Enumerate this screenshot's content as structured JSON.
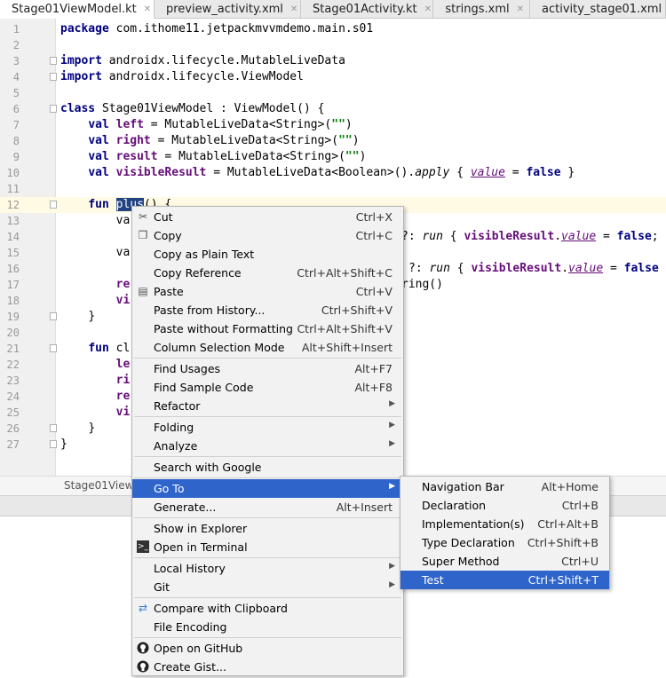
{
  "tabs": [
    {
      "label": "Stage01ViewModel.kt",
      "active": true,
      "icon": "kotlin-class-icon"
    },
    {
      "label": "preview_activity.xml",
      "active": false,
      "icon": "xml-layout-icon"
    },
    {
      "label": "Stage01Activity.kt",
      "active": false,
      "icon": "kotlin-class-icon"
    },
    {
      "label": "strings.xml",
      "active": false,
      "icon": "xml-values-icon"
    },
    {
      "label": "activity_stage01.xml",
      "active": false,
      "icon": "xml-layout-icon"
    }
  ],
  "line_numbers": [
    "1",
    "2",
    "3",
    "4",
    "5",
    "6",
    "7",
    "8",
    "9",
    "10",
    "11",
    "12",
    "13",
    "14",
    "15",
    "16",
    "17",
    "18",
    "19",
    "20",
    "21",
    "22",
    "23",
    "24",
    "25",
    "26",
    "27"
  ],
  "code": {
    "l1": {
      "kw": "package",
      "rest": " com.ithome11.jetpackmvvmdemo.main.s01"
    },
    "l3": {
      "kw": "import",
      "rest": " androidx.lifecycle.MutableLiveData"
    },
    "l4": {
      "kw": "import",
      "rest": " androidx.lifecycle.ViewModel"
    },
    "l6": {
      "kw": "class",
      "rest": " Stage01ViewModel : ViewModel() {"
    },
    "l7": {
      "kw": "val",
      "name": "left",
      "a": " = MutableLiveData<String>(",
      "s": "\"\"",
      "b": ")"
    },
    "l8": {
      "kw": "val",
      "name": "right",
      "a": " = MutableLiveData<String>(",
      "s": "\"\"",
      "b": ")"
    },
    "l9": {
      "kw": "val",
      "name": "result",
      "a": " = MutableLiveData<String>(",
      "s": "\"\"",
      "b": ")"
    },
    "l10": {
      "kw": "val",
      "name": "visibleResult",
      "a": " = MutableLiveData<Boolean>().",
      "apply": "apply",
      "c": " { ",
      "value": "value",
      "d": " = ",
      "false": "false",
      "e": " }"
    },
    "l12": {
      "kw": "fun",
      "sel": "plus",
      "rest": "() {"
    },
    "l13": "va",
    "l14": {
      "a": "?: ",
      "run": "run",
      "b": " { ",
      "vr": "visibleResult",
      "c": ".",
      "value": "value",
      "d": " = ",
      "false": "false",
      "e": ";"
    },
    "l15": "va",
    "l16": {
      "a": "?: ",
      "run": "run",
      "b": " { ",
      "vr": "visibleResult",
      "c": ".",
      "value": "value",
      "d": " = ",
      "false": "false"
    },
    "l17a": "re",
    "l17b": "ring()",
    "l18": "vi",
    "l20": "}",
    "l21": {
      "kw": "fun",
      "rest": " cl"
    },
    "l22": "le",
    "l23": "ri",
    "l24": "re",
    "l25": "vi",
    "l26": "}",
    "l27": "}"
  },
  "breadcrumb": "Stage01ViewM",
  "context_menu": {
    "items": [
      {
        "label": "Cut",
        "shortcut": "Ctrl+X",
        "icon": "scissors-icon"
      },
      {
        "label": "Copy",
        "shortcut": "Ctrl+C",
        "icon": "copy-icon"
      },
      {
        "label": "Copy as Plain Text",
        "shortcut": ""
      },
      {
        "label": "Copy Reference",
        "shortcut": "Ctrl+Alt+Shift+C"
      },
      {
        "label": "Paste",
        "shortcut": "Ctrl+V",
        "icon": "paste-icon"
      },
      {
        "label": "Paste from History...",
        "shortcut": "Ctrl+Shift+V"
      },
      {
        "label": "Paste without Formatting",
        "shortcut": "Ctrl+Alt+Shift+V"
      },
      {
        "label": "Column Selection Mode",
        "shortcut": "Alt+Shift+Insert"
      },
      {
        "label": "Find Usages",
        "shortcut": "Alt+F7"
      },
      {
        "label": "Find Sample Code",
        "shortcut": "Alt+F8"
      },
      {
        "label": "Refactor",
        "submenu": true
      },
      {
        "label": "Folding",
        "submenu": true
      },
      {
        "label": "Analyze",
        "submenu": true
      },
      {
        "label": "Search with Google",
        "shortcut": ""
      },
      {
        "label": "Go To",
        "submenu": true,
        "highlighted": true
      },
      {
        "label": "Generate...",
        "shortcut": "Alt+Insert"
      },
      {
        "label": "Show in Explorer",
        "shortcut": ""
      },
      {
        "label": "Open in Terminal",
        "shortcut": "",
        "icon": "terminal-icon"
      },
      {
        "label": "Local History",
        "submenu": true
      },
      {
        "label": "Git",
        "submenu": true
      },
      {
        "label": "Compare with Clipboard",
        "shortcut": "",
        "icon": "compare-icon"
      },
      {
        "label": "File Encoding",
        "shortcut": ""
      },
      {
        "label": "Open on GitHub",
        "shortcut": "",
        "icon": "github-icon"
      },
      {
        "label": "Create Gist...",
        "shortcut": "",
        "icon": "github-icon"
      }
    ]
  },
  "goto_submenu": {
    "items": [
      {
        "label": "Navigation Bar",
        "shortcut": "Alt+Home"
      },
      {
        "label": "Declaration",
        "shortcut": "Ctrl+B"
      },
      {
        "label": "Implementation(s)",
        "shortcut": "Ctrl+Alt+B"
      },
      {
        "label": "Type Declaration",
        "shortcut": "Ctrl+Shift+B"
      },
      {
        "label": "Super Method",
        "shortcut": "Ctrl+U"
      },
      {
        "label": "Test",
        "shortcut": "Ctrl+Shift+T",
        "highlighted": true
      }
    ]
  },
  "colors": {
    "highlight": "#2f65ca",
    "keyword": "#000080",
    "property": "#660e7a",
    "string": "#008000",
    "current_line": "#fffae3"
  }
}
